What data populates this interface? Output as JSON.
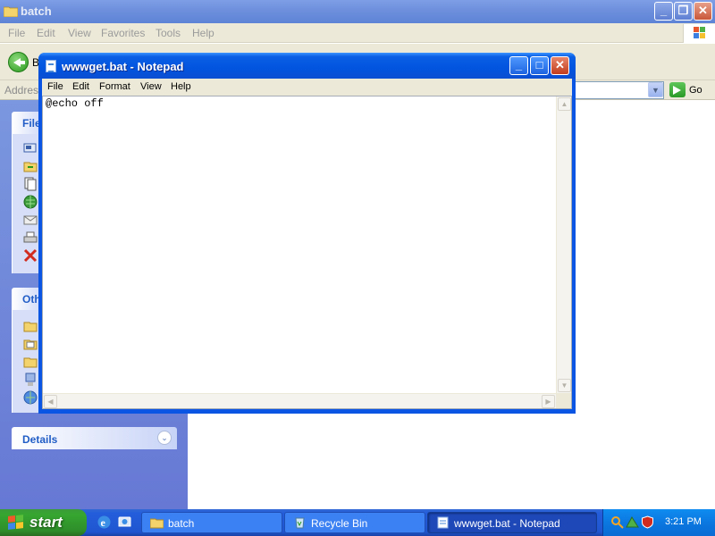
{
  "explorer": {
    "title": "batch",
    "menu": [
      "File",
      "Edit",
      "View",
      "Favorites",
      "Tools",
      "Help"
    ],
    "toolbar": {
      "back_label": "B"
    },
    "address": {
      "label": "Address",
      "go_label": "Go"
    },
    "left_panel": {
      "file_tasks_title": "File",
      "other_places_title": "Oth",
      "details_title": "Details"
    }
  },
  "notepad": {
    "title": "wwwget.bat - Notepad",
    "menu": [
      "File",
      "Edit",
      "Format",
      "View",
      "Help"
    ],
    "content": "@echo off"
  },
  "taskbar": {
    "start_label": "start",
    "tasks": [
      {
        "label": "batch",
        "icon": "folder-icon",
        "active": false
      },
      {
        "label": "Recycle Bin",
        "icon": "recycle-bin-icon",
        "active": false
      },
      {
        "label": "wwwget.bat - Notepad",
        "icon": "notepad-icon",
        "active": true
      }
    ],
    "clock": "3:21 PM"
  },
  "colors": {
    "xp_blue": "#0a55e3",
    "start_green": "#36a630",
    "task_pane": "#7b97df",
    "menu_bg": "#ece9d8"
  }
}
